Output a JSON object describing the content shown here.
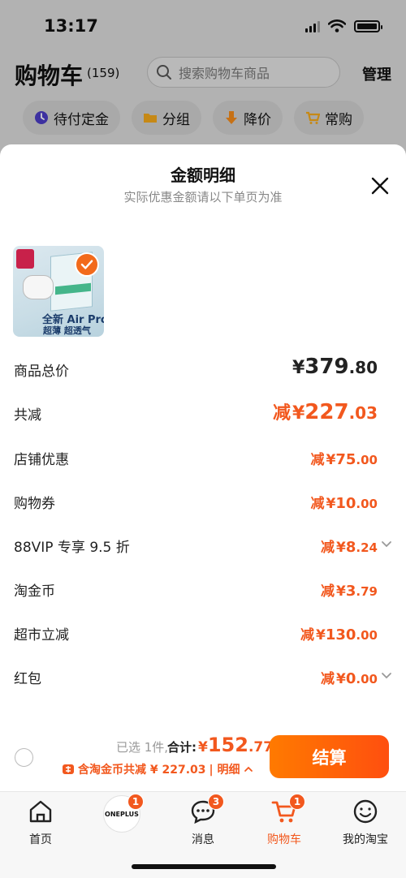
{
  "status_bar": {
    "time": "13:17"
  },
  "cart_header": {
    "title": "购物车",
    "count": "(159)",
    "search_placeholder": "搜索购物车商品",
    "manage_label": "管理"
  },
  "filters": [
    {
      "label": "待付定金",
      "icon": "clock-icon"
    },
    {
      "label": "分组",
      "icon": "folder-icon"
    },
    {
      "label": "降价",
      "icon": "price-drop-icon"
    },
    {
      "label": "常购",
      "icon": "cart-icon"
    }
  ],
  "sheet": {
    "title": "金额明细",
    "subtitle": "实际优惠金额请以下单页为准",
    "product": {
      "image_text_line1": "全新 Air Pro",
      "image_text_line2": "超薄 超透气",
      "selected": true
    },
    "rows": [
      {
        "label": "商品总价",
        "prefix": "",
        "yen": "¥",
        "int": "379",
        "dec": ".80",
        "style": "black",
        "chevron": false
      },
      {
        "label": "共减",
        "prefix": "减",
        "yen": "¥",
        "int": "227",
        "dec": ".03",
        "style": "large",
        "chevron": false
      },
      {
        "label": "店铺优惠",
        "prefix": "减",
        "yen": "¥",
        "int": "75",
        "dec": ".00",
        "style": "normal",
        "chevron": false
      },
      {
        "label": "购物券",
        "prefix": "减",
        "yen": "¥",
        "int": "10",
        "dec": ".00",
        "style": "normal",
        "chevron": false
      },
      {
        "label": "88VIP 专享 9.5 折",
        "prefix": "减",
        "yen": "¥",
        "int": "8",
        "dec": ".24",
        "style": "normal",
        "chevron": true
      },
      {
        "label": "淘金币",
        "prefix": "减",
        "yen": "¥",
        "int": "3",
        "dec": ".79",
        "style": "normal",
        "chevron": false
      },
      {
        "label": "超市立减",
        "prefix": "减",
        "yen": "¥",
        "int": "130",
        "dec": ".00",
        "style": "normal",
        "chevron": false
      },
      {
        "label": "红包",
        "prefix": "减",
        "yen": "¥",
        "int": "0",
        "dec": ".00",
        "style": "normal",
        "chevron": true
      }
    ]
  },
  "checkout": {
    "selected_text": "已选 1件,",
    "total_label": "合计:",
    "total_yen": "¥",
    "total_int": "152",
    "total_dec": ".77",
    "coin_text": "含淘金币共减 ¥ 227.03",
    "detail_label": "| 明细",
    "button_label": "结算"
  },
  "tabbar": [
    {
      "label": "首页",
      "icon": "home-icon",
      "badge": ""
    },
    {
      "label": "",
      "icon": "oneplus-avatar",
      "badge": "1"
    },
    {
      "label": "消息",
      "icon": "message-icon",
      "badge": "3"
    },
    {
      "label": "购物车",
      "icon": "cart-icon",
      "badge": "1",
      "active": true
    },
    {
      "label": "我的淘宝",
      "icon": "profile-icon",
      "badge": ""
    }
  ],
  "avatar_text": "ONEPLUS",
  "colors": {
    "accent": "#f2581e",
    "button_start": "#ff7a00",
    "button_end": "#ff4f0f"
  }
}
